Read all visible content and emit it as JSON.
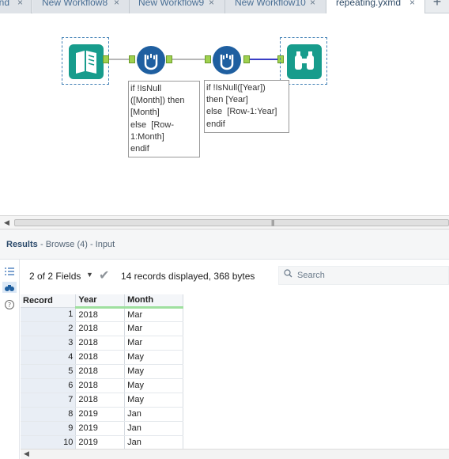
{
  "tabs": [
    {
      "label": "ind"
    },
    {
      "label": "New Workflow8"
    },
    {
      "label": "New Workflow9"
    },
    {
      "label": "New Workflow10"
    },
    {
      "label": "repeating.yxmd"
    }
  ],
  "add_tab_glyph": "+",
  "close_glyph": "×",
  "canvas": {
    "tools": [
      {
        "name": "input-data-tool",
        "icon": "book-icon"
      },
      {
        "name": "formula-tool-1",
        "icon": "formula-icon"
      },
      {
        "name": "formula-tool-2",
        "icon": "formula-icon"
      },
      {
        "name": "browse-tool",
        "icon": "binoculars-icon"
      }
    ],
    "annotation1": "if !IsNull\n([Month]) then\n[Month]\nelse  [Row-\n1:Month]\nendif",
    "annotation2": "if !IsNull([Year])\nthen [Year]\nelse  [Row-1:Year]\nendif"
  },
  "scrollbar": {
    "grip": "|||"
  },
  "results": {
    "title": "Results",
    "subtitle": "- Browse (4) - Input",
    "fields_selector": "2 of 2 Fields",
    "record_info": "14 records displayed, 368 bytes",
    "search_placeholder": "Search",
    "columns": [
      "Record",
      "Year",
      "Month"
    ],
    "rows": [
      [
        "1",
        "2018",
        "Mar"
      ],
      [
        "2",
        "2018",
        "Mar"
      ],
      [
        "3",
        "2018",
        "Mar"
      ],
      [
        "4",
        "2018",
        "May"
      ],
      [
        "5",
        "2018",
        "May"
      ],
      [
        "6",
        "2018",
        "May"
      ],
      [
        "7",
        "2018",
        "May"
      ],
      [
        "8",
        "2019",
        "Jan"
      ],
      [
        "9",
        "2019",
        "Jan"
      ],
      [
        "10",
        "2019",
        "Jan"
      ]
    ]
  },
  "left_icons": [
    "list-icon",
    "binoculars-icon",
    "help-icon"
  ]
}
